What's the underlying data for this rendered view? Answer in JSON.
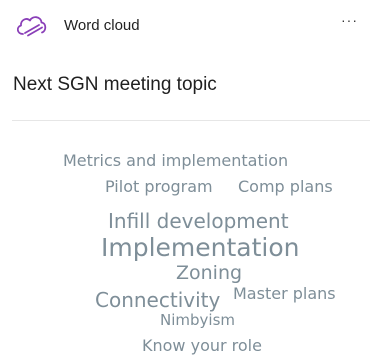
{
  "header": {
    "icon": "word-cloud-icon",
    "type_label": "Word cloud",
    "more_label": "···"
  },
  "question": {
    "title": "Next SGN meeting topic"
  },
  "colors": {
    "icon_purple": "#8a3fb8",
    "word_gray": "#7e8e98",
    "divider": "#e6e6e6"
  },
  "words": {
    "metrics": "Metrics and implementation",
    "pilot": "Pilot program",
    "comp": "Comp plans",
    "infill": "Infill development",
    "implementation": "Implementation",
    "zoning": "Zoning",
    "connectivity": "Connectivity",
    "master": "Master plans",
    "nimbyism": "Nimbyism",
    "know": "Know your role"
  }
}
